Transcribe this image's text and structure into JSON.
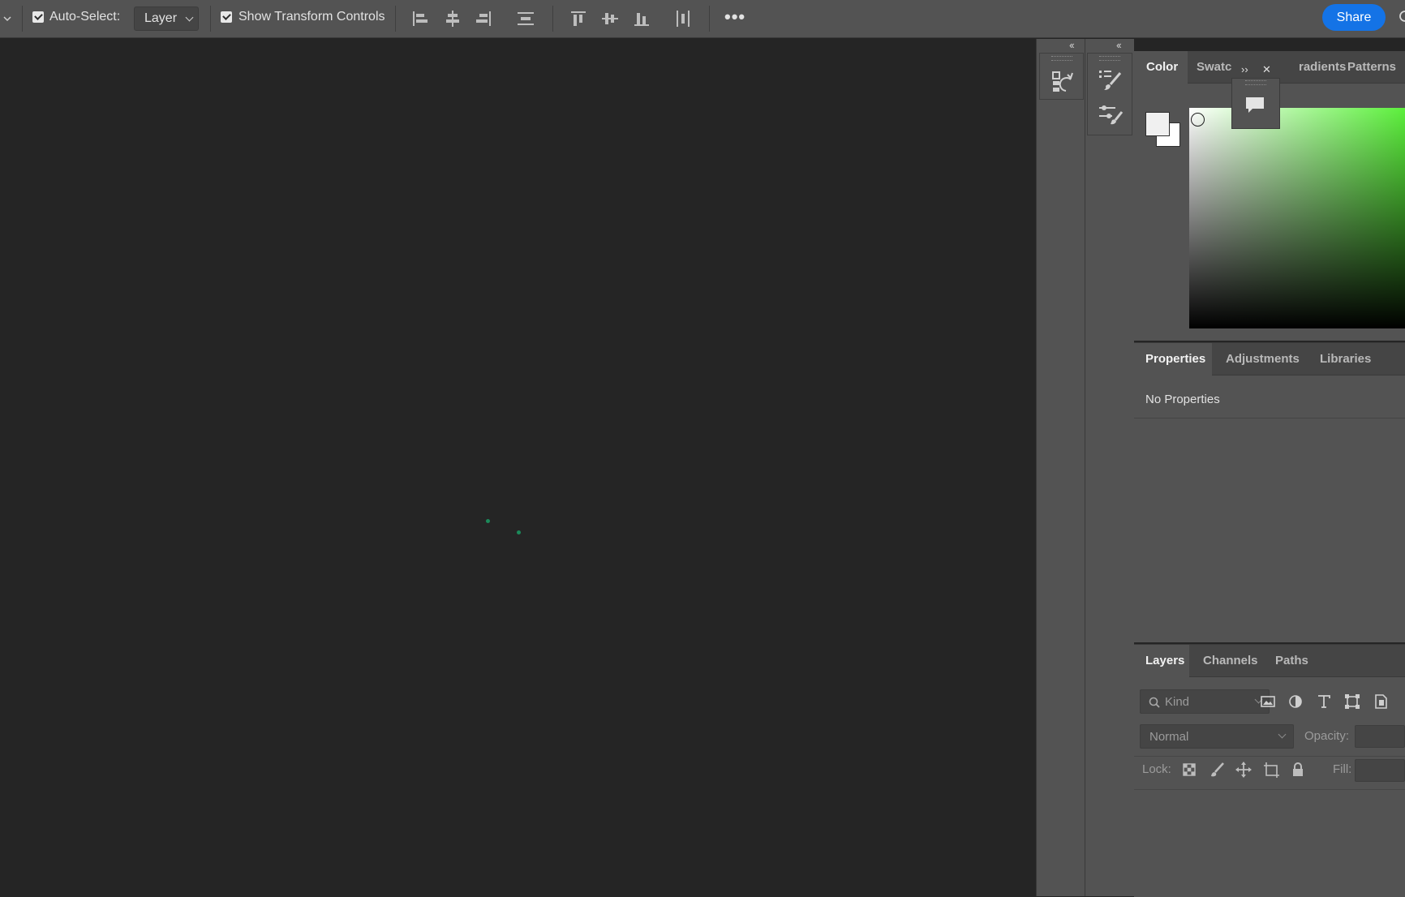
{
  "options_bar": {
    "auto_select_label": "Auto-Select:",
    "auto_select_checked": true,
    "layer_dropdown_value": "Layer",
    "show_transform_label": "Show Transform Controls",
    "show_transform_checked": true,
    "more_label": "•••",
    "share_label": "Share"
  },
  "color_panel": {
    "tabs": [
      "Color",
      "Swatches",
      "Gradients",
      "Patterns"
    ],
    "tab_visible_text": [
      "Color",
      "Swatc",
      "radients",
      "Patterns"
    ],
    "active_tab": "Color",
    "foreground_color": "#f0f0f0",
    "background_color": "#ffffff",
    "hue_color": "#5cf03c"
  },
  "properties_panel": {
    "tabs": [
      "Properties",
      "Adjustments",
      "Libraries"
    ],
    "active_tab": "Properties",
    "empty_text": "No Properties"
  },
  "layers_panel": {
    "tabs": [
      "Layers",
      "Channels",
      "Paths"
    ],
    "active_tab": "Layers",
    "filter_placeholder": "Kind",
    "blend_mode": "Normal",
    "opacity_label": "Opacity:",
    "lock_label": "Lock:",
    "fill_label": "Fill:"
  },
  "floating_panel": {
    "expand_label": "››",
    "close_label": "✕"
  },
  "dock": {
    "collapse_label": "‹‹"
  },
  "colors": {
    "accent": "#1473e6",
    "spinner": "#1b8a5a"
  }
}
